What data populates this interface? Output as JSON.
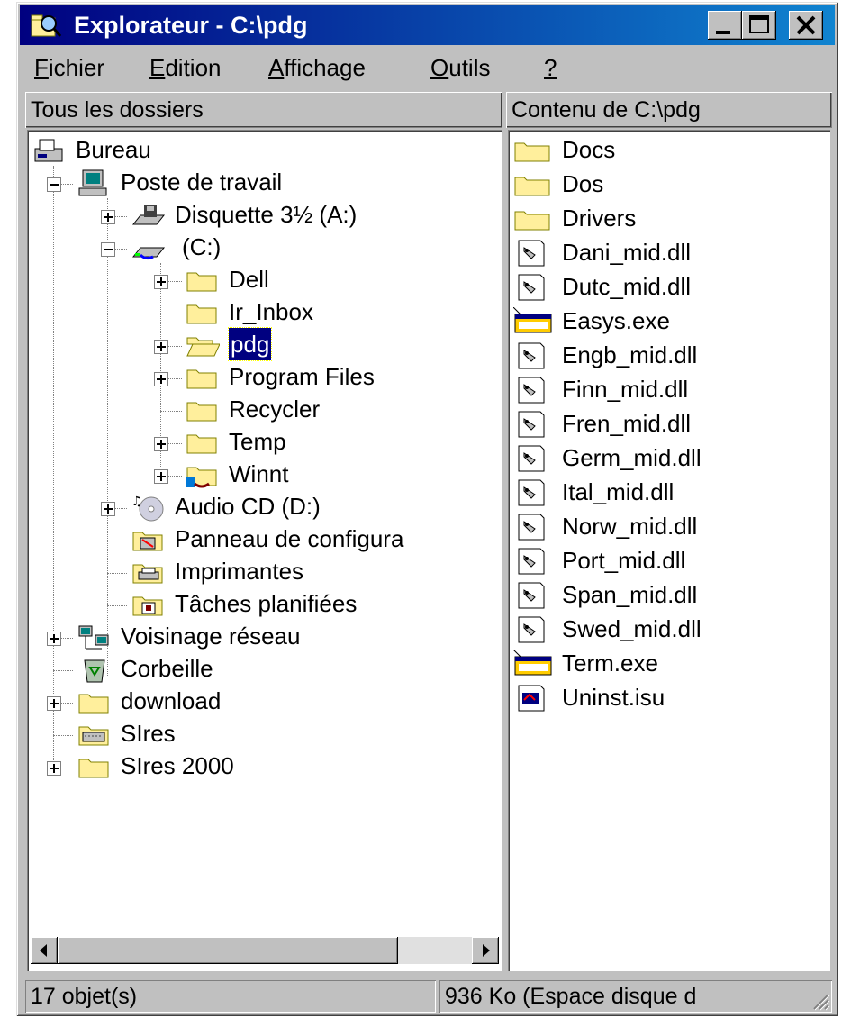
{
  "window": {
    "title": "Explorateur - C:\\pdg",
    "title_icon": "explorer-icon"
  },
  "menu": [
    {
      "first": "F",
      "rest": "ichier"
    },
    {
      "first": "E",
      "rest": "dition"
    },
    {
      "first": "A",
      "rest": "ffichage"
    },
    {
      "first": "O",
      "rest": "utils"
    },
    {
      "first": "?",
      "rest": ""
    }
  ],
  "left_pane": {
    "header": "Tous les dossiers",
    "tree": [
      {
        "label": "Bureau",
        "icon": "desktop-icon"
      },
      {
        "label": "Poste de travail",
        "icon": "computer-icon"
      },
      {
        "label": "Disquette 3½ (A:)",
        "icon": "floppy-drive-icon"
      },
      {
        "label": "(C:)",
        "icon": "hard-drive-icon"
      },
      {
        "label": "Dell",
        "icon": "folder-icon"
      },
      {
        "label": "Ir_Inbox",
        "icon": "folder-icon"
      },
      {
        "label": "pdg",
        "icon": "folder-open-icon"
      },
      {
        "label": "Program Files",
        "icon": "folder-icon"
      },
      {
        "label": "Recycler",
        "icon": "folder-icon"
      },
      {
        "label": "Temp",
        "icon": "folder-icon"
      },
      {
        "label": "Winnt",
        "icon": "shared-folder-icon"
      },
      {
        "label": "Audio CD (D:)",
        "icon": "cd-drive-icon"
      },
      {
        "label": "Panneau de configura",
        "icon": "control-panel-icon"
      },
      {
        "label": "Imprimantes",
        "icon": "printers-icon"
      },
      {
        "label": "Tâches planifiées",
        "icon": "scheduled-tasks-icon"
      },
      {
        "label": "Voisinage réseau",
        "icon": "network-icon"
      },
      {
        "label": "Corbeille",
        "icon": "recycle-bin-icon"
      },
      {
        "label": "download",
        "icon": "folder-icon"
      },
      {
        "label": "SIres",
        "icon": "keyboard-folder-icon"
      },
      {
        "label": "SIres 2000",
        "icon": "folder-icon"
      }
    ],
    "selected": "pdg"
  },
  "right_pane": {
    "header": "Contenu de C:\\pdg",
    "files": [
      {
        "label": "Docs",
        "icon": "folder-icon"
      },
      {
        "label": "Dos",
        "icon": "folder-icon"
      },
      {
        "label": "Drivers",
        "icon": "folder-icon"
      },
      {
        "label": "Dani_mid.dll",
        "icon": "dll-icon"
      },
      {
        "label": "Dutc_mid.dll",
        "icon": "dll-icon"
      },
      {
        "label": "Easys.exe",
        "icon": "exe-icon"
      },
      {
        "label": "Engb_mid.dll",
        "icon": "dll-icon"
      },
      {
        "label": "Finn_mid.dll",
        "icon": "dll-icon"
      },
      {
        "label": "Fren_mid.dll",
        "icon": "dll-icon"
      },
      {
        "label": "Germ_mid.dll",
        "icon": "dll-icon"
      },
      {
        "label": "Ital_mid.dll",
        "icon": "dll-icon"
      },
      {
        "label": "Norw_mid.dll",
        "icon": "dll-icon"
      },
      {
        "label": "Port_mid.dll",
        "icon": "dll-icon"
      },
      {
        "label": "Span_mid.dll",
        "icon": "dll-icon"
      },
      {
        "label": "Swed_mid.dll",
        "icon": "dll-icon"
      },
      {
        "label": "Term.exe",
        "icon": "exe-icon"
      },
      {
        "label": "Uninst.isu",
        "icon": "isu-icon"
      }
    ]
  },
  "status": {
    "objects": "17 objet(s)",
    "space": "936 Ko (Espace disque d"
  },
  "colors": {
    "titlebar": "#000080",
    "face": "#c0c0c0",
    "selection": "#000080",
    "folder": "#ffef9c"
  }
}
